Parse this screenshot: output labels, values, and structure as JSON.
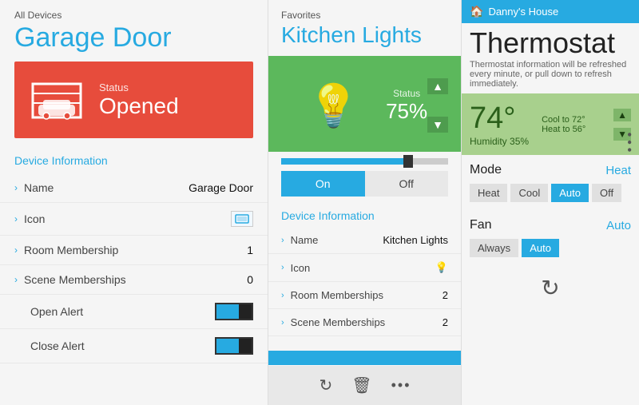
{
  "left": {
    "breadcrumb": "All Devices",
    "title": "Garage Door",
    "status_label": "Status",
    "status_value": "Opened",
    "section_title": "Device Information",
    "rows": [
      {
        "label": "Name",
        "value": "Garage Door",
        "type": "text"
      },
      {
        "label": "Icon",
        "value": "🚗",
        "type": "icon"
      },
      {
        "label": "Room Membership",
        "value": "1",
        "type": "text"
      },
      {
        "label": "Scene Memberships",
        "value": "0",
        "type": "text"
      }
    ],
    "toggle_rows": [
      {
        "label": "Open Alert"
      },
      {
        "label": "Close Alert"
      }
    ]
  },
  "mid": {
    "breadcrumb": "Favorites",
    "title": "Kitchen Lights",
    "status_label": "Status",
    "status_value": "75%",
    "btn_on": "On",
    "btn_off": "Off",
    "section_title": "Device Information",
    "rows": [
      {
        "label": "Name",
        "value": "Kitchen Lights",
        "type": "text"
      },
      {
        "label": "Icon",
        "value": "💡",
        "type": "icon"
      },
      {
        "label": "Room Memberships",
        "value": "2",
        "type": "text"
      },
      {
        "label": "Scene Memberships",
        "value": "2",
        "type": "text"
      }
    ]
  },
  "right": {
    "header_breadcrumb": "Danny's House",
    "title": "Thermostat",
    "subtitle": "Thermostat information will be refreshed every minute, or pull down to refresh immediately.",
    "temp": "74°",
    "cool_to_label": "Cool to",
    "cool_to_value": "72°",
    "heat_to_label": "Heat to",
    "heat_to_value": "56°",
    "humidity_label": "Humidity",
    "humidity_value": "35%",
    "mode_label": "Mode",
    "mode_value": "Heat",
    "mode_buttons": [
      "Heat",
      "Cool",
      "Auto",
      "Off"
    ],
    "mode_active": "Auto",
    "fan_label": "Fan",
    "fan_value": "Auto",
    "fan_buttons": [
      "Always",
      "Auto"
    ],
    "fan_active": "Auto"
  }
}
